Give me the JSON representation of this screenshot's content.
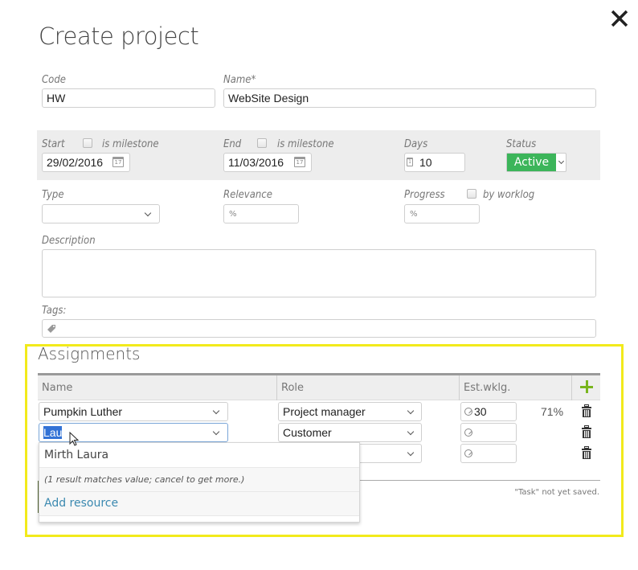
{
  "dialog": {
    "title": "Create project",
    "close_icon": "close-icon"
  },
  "form": {
    "code": {
      "label": "Code",
      "value": "HW"
    },
    "name": {
      "label": "Name*",
      "value": "WebSite Design"
    },
    "start": {
      "label": "Start",
      "milestone_label": "is milestone",
      "milestone_checked": false,
      "value": "29/02/2016",
      "icon": "calendar-icon"
    },
    "end": {
      "label": "End",
      "milestone_label": "is milestone",
      "milestone_checked": false,
      "value": "11/03/2016",
      "icon": "calendar-icon"
    },
    "days": {
      "label": "Days",
      "value": "10",
      "icon": "calendar-day-icon"
    },
    "status": {
      "label": "Status",
      "value": "Active",
      "color": "#3cb55a"
    },
    "type": {
      "label": "Type",
      "value": ""
    },
    "relevance": {
      "label": "Relevance",
      "value": "",
      "unit_icon": "%"
    },
    "progress": {
      "label": "Progress",
      "by_worklog_label": "by worklog",
      "by_worklog_checked": false,
      "value": "",
      "unit_icon": "%"
    },
    "description": {
      "label": "Description",
      "value": ""
    },
    "tags": {
      "label": "Tags:",
      "value": "",
      "icon": "tag-icon"
    }
  },
  "assignments": {
    "title": "Assignments",
    "columns": [
      "Name",
      "Role",
      "Est.wklg."
    ],
    "add_icon": "plus-icon",
    "rows": [
      {
        "name": "Pumpkin Luther",
        "role": "Project manager",
        "est_worklog": "30",
        "percent": "71%"
      },
      {
        "name": "Lau",
        "role": "Customer",
        "est_worklog": "",
        "percent": ""
      },
      {
        "name": "",
        "role": "",
        "est_worklog": "",
        "percent": ""
      }
    ],
    "autocomplete": {
      "results": [
        "Mirth Laura"
      ],
      "message": "(1 result matches value; cancel to get more.)",
      "add_label": "Add resource"
    },
    "footer_note": "\"Task\" not yet saved.",
    "highlight_color": "#f2ea1b"
  }
}
